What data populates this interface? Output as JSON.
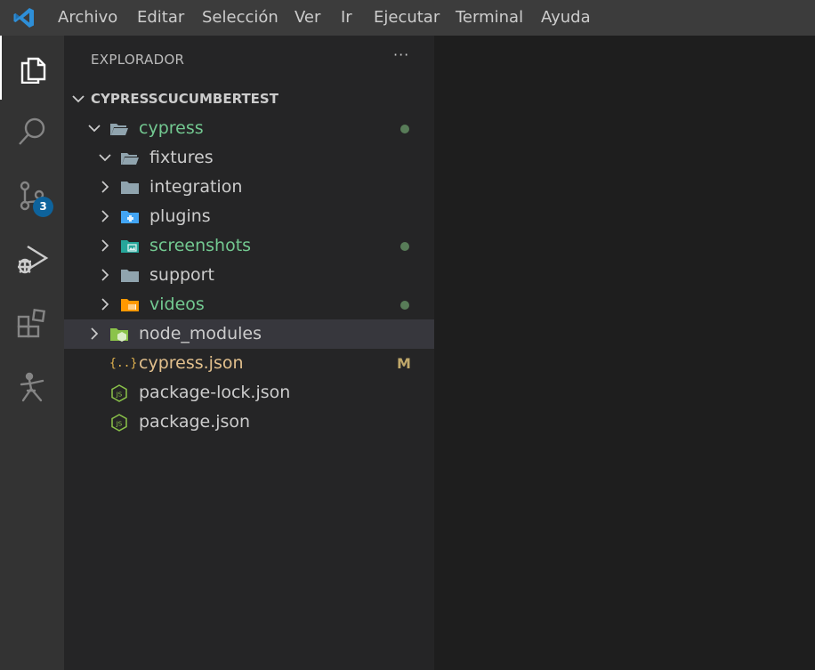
{
  "menu": [
    "Archivo",
    "Editar",
    "Selección",
    "Ver",
    "Ir",
    "Ejecutar",
    "Terminal",
    "Ayuda"
  ],
  "activity": {
    "scm_badge": "3"
  },
  "explorer": {
    "title": "EXPLORADOR",
    "more": "···",
    "root_label": "CYPRESSCUCUMBERTEST",
    "items": [
      {
        "label": "cypress",
        "color": "#73c991",
        "status": "dot"
      },
      {
        "label": "fixtures",
        "color": "#cccccc"
      },
      {
        "label": "integration",
        "color": "#cccccc"
      },
      {
        "label": "plugins",
        "color": "#cccccc"
      },
      {
        "label": "screenshots",
        "color": "#73c991",
        "status": "dot"
      },
      {
        "label": "support",
        "color": "#cccccc"
      },
      {
        "label": "videos",
        "color": "#73c991",
        "status": "dot"
      },
      {
        "label": "node_modules",
        "color": "#cccccc"
      },
      {
        "label": "cypress.json",
        "color": "#e2c08d",
        "status": "M",
        "icon_text": "{..}"
      },
      {
        "label": "package-lock.json",
        "color": "#cccccc",
        "icon_text": "JS"
      },
      {
        "label": "package.json",
        "color": "#cccccc",
        "icon_text": "JS"
      }
    ]
  },
  "colors": {
    "modified": "#e2c08d",
    "untracked": "#73c991",
    "accent": "#0e639c"
  }
}
